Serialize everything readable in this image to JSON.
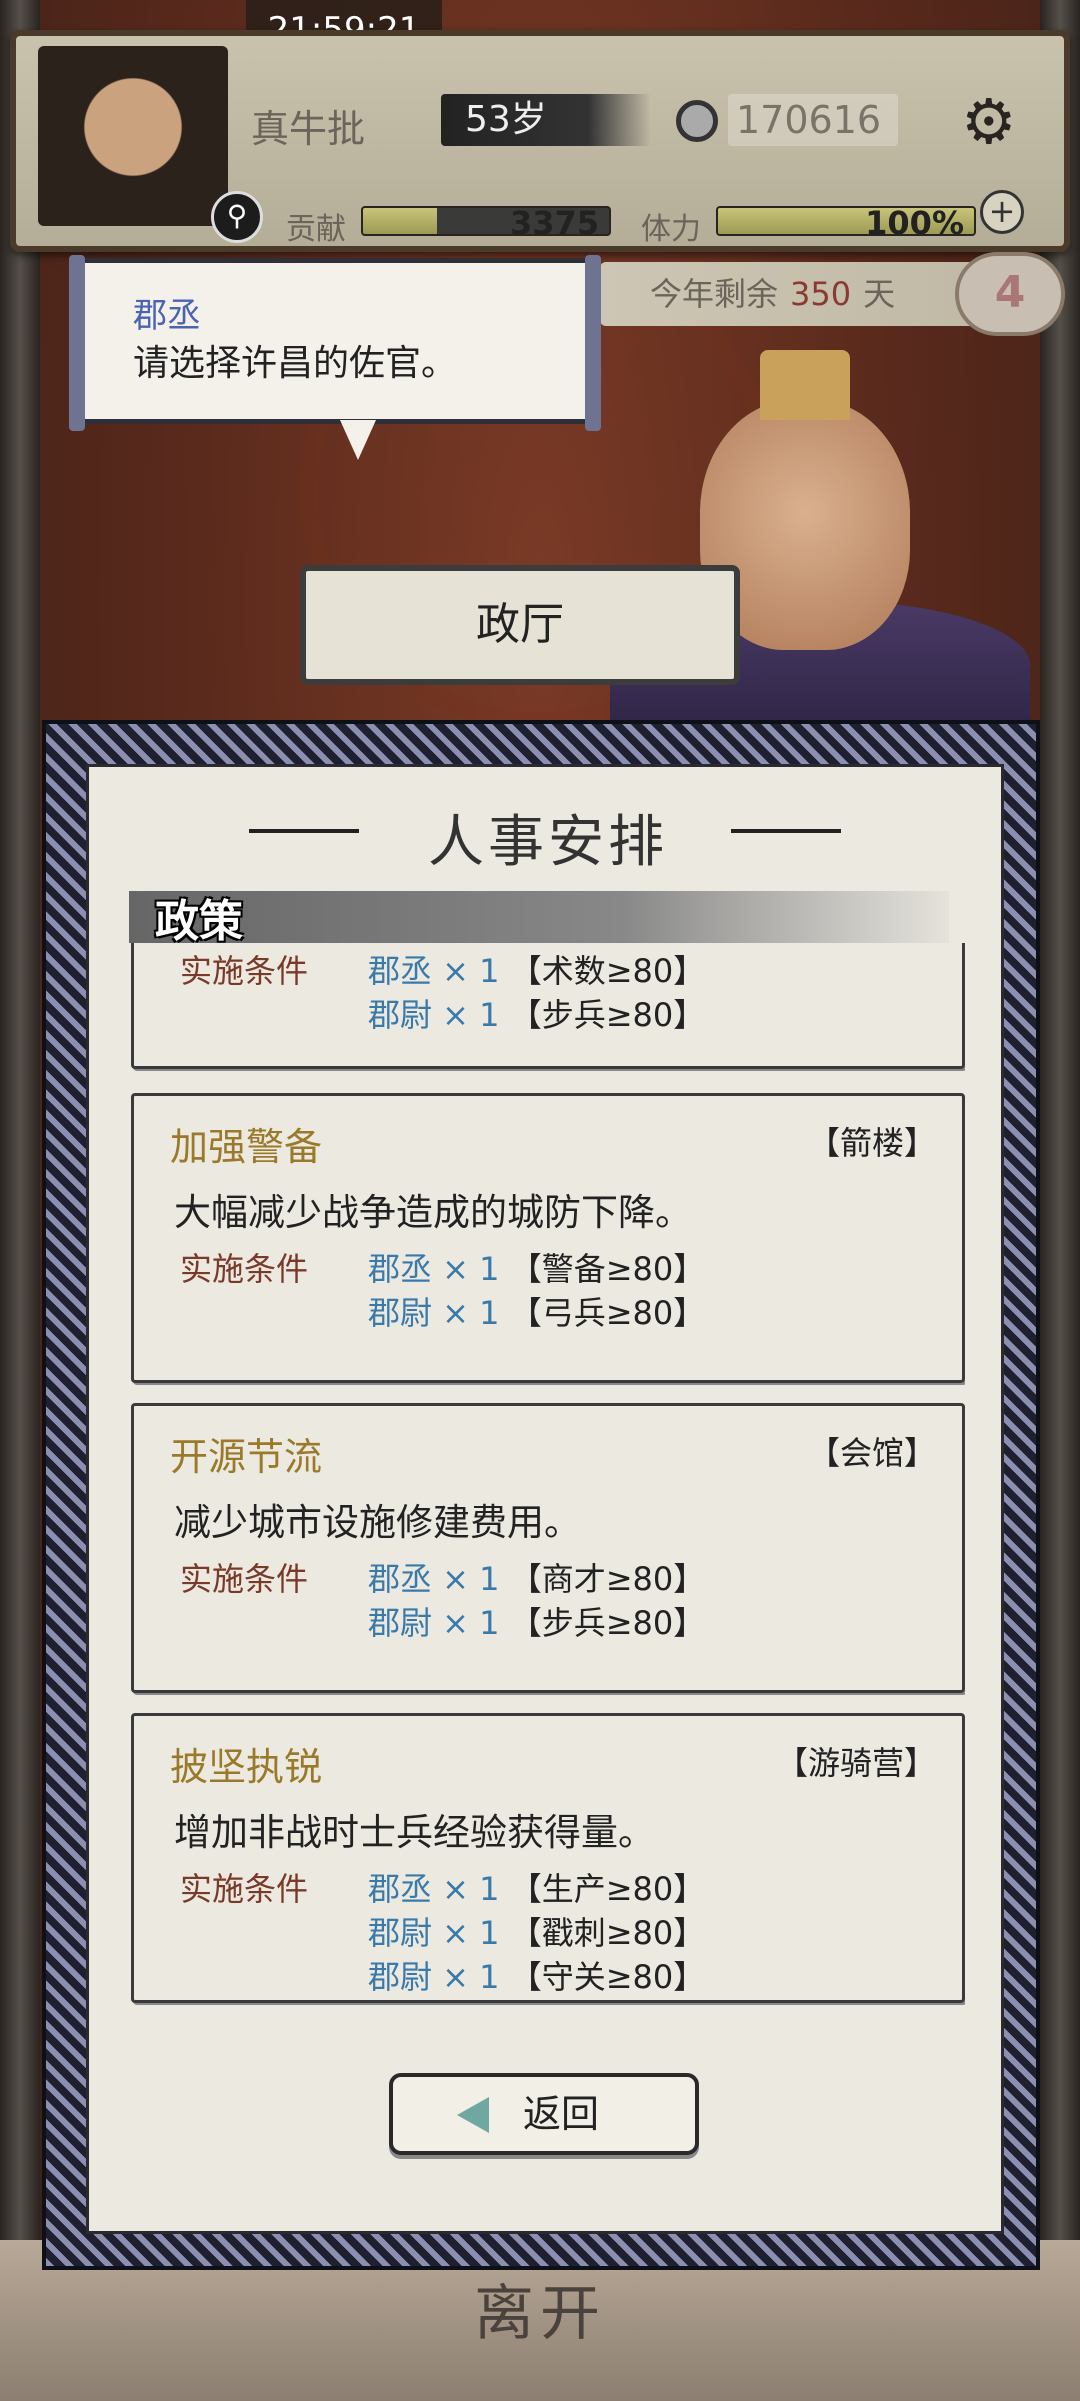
{
  "status_bar": {
    "time": "21:59:21"
  },
  "player": {
    "name": "真牛批",
    "age": "53岁",
    "money": "170616",
    "contribution_label": "贡献",
    "contribution_value": "3375",
    "contribution_fill": 0.3,
    "stamina_label": "体力",
    "stamina_value": "100%",
    "stamina_fill": 1.0
  },
  "calendar": {
    "prefix": "今年剩余",
    "days": "350",
    "suffix": "天",
    "badge": "4"
  },
  "speech": {
    "speaker": "郡丞",
    "text": "请选择许昌的佐官。"
  },
  "hall": {
    "name": "政厅"
  },
  "dialog": {
    "title": "人事安排",
    "section": "政策",
    "req_label": "实施条件",
    "back_label": "返回"
  },
  "policies": [
    {
      "name": "",
      "building": "",
      "desc": "",
      "requirements": [
        {
          "officer": "郡丞 × 1",
          "cond": "【术数≥80】"
        },
        {
          "officer": "郡尉 × 1",
          "cond": "【步兵≥80】"
        }
      ]
    },
    {
      "name": "加强警备",
      "building": "【箭楼】",
      "desc": "大幅减少战争造成的城防下降。",
      "requirements": [
        {
          "officer": "郡丞 × 1",
          "cond": "【警备≥80】"
        },
        {
          "officer": "郡尉 × 1",
          "cond": "【弓兵≥80】"
        }
      ]
    },
    {
      "name": "开源节流",
      "building": "【会馆】",
      "desc": "减少城市设施修建费用。",
      "requirements": [
        {
          "officer": "郡丞 × 1",
          "cond": "【商才≥80】"
        },
        {
          "officer": "郡尉 × 1",
          "cond": "【步兵≥80】"
        }
      ]
    },
    {
      "name": "披坚执锐",
      "building": "【游骑营】",
      "desc": "增加非战时士兵经验获得量。",
      "requirements": [
        {
          "officer": "郡丞 × 1",
          "cond": "【生产≥80】"
        },
        {
          "officer": "郡尉 × 1",
          "cond": "【戳刺≥80】"
        },
        {
          "officer": "郡尉 × 1",
          "cond": "【守关≥80】"
        }
      ]
    }
  ],
  "footer": {
    "leave_label": "离开"
  },
  "colors": {
    "accent_gold": "#9a7a2a",
    "officer_blue": "#3a7aaa",
    "req_red": "#7a3a2a"
  }
}
